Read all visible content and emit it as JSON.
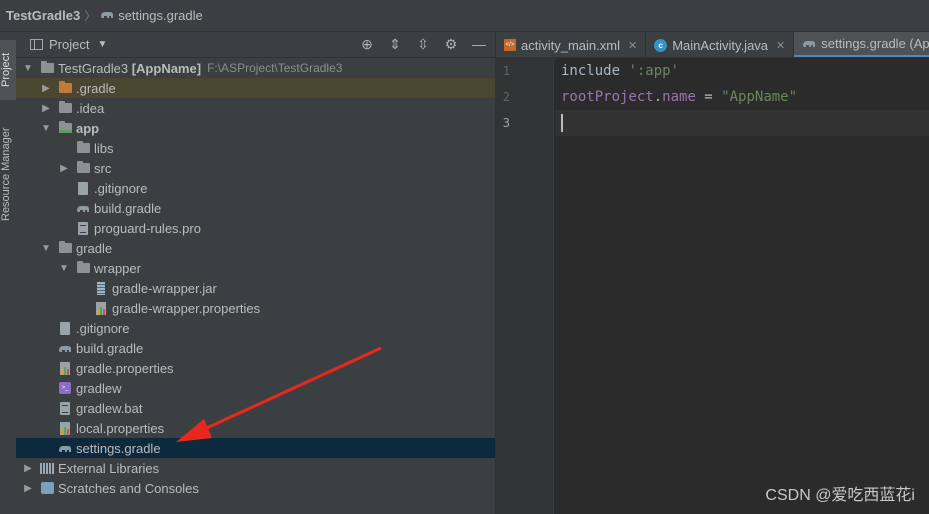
{
  "breadcrumb": {
    "project": "TestGradle3",
    "file": "settings.gradle"
  },
  "side_strip": {
    "project_tab": "Project",
    "resource_tab": "Resource Manager"
  },
  "project_panel": {
    "title": "Project"
  },
  "tree": [
    {
      "label": "TestGradle3",
      "extra": "[AppName]",
      "path": "F:\\ASProject\\TestGradle3",
      "icon": "project-folder-icon",
      "expanded": true,
      "bold": false
    },
    {
      "label": ".gradle",
      "icon": "folder-orange-icon",
      "expanded": false,
      "highlight": true
    },
    {
      "label": ".idea",
      "icon": "folder-icon",
      "expanded": false
    },
    {
      "label": "app",
      "icon": "module-folder-icon",
      "expanded": true,
      "bold": true
    },
    {
      "label": "libs",
      "icon": "folder-icon"
    },
    {
      "label": "src",
      "icon": "folder-icon",
      "expanded": false
    },
    {
      "label": ".gitignore",
      "icon": "gitignore-icon"
    },
    {
      "label": "build.gradle",
      "icon": "gradle-elephant-icon"
    },
    {
      "label": "proguard-rules.pro",
      "icon": "text-file-icon"
    },
    {
      "label": "gradle",
      "icon": "folder-icon",
      "expanded": true
    },
    {
      "label": "wrapper",
      "icon": "folder-icon",
      "expanded": true
    },
    {
      "label": "gradle-wrapper.jar",
      "icon": "jar-icon"
    },
    {
      "label": "gradle-wrapper.properties",
      "icon": "properties-icon"
    },
    {
      "label": ".gitignore",
      "icon": "gitignore-icon"
    },
    {
      "label": "build.gradle",
      "icon": "gradle-elephant-icon"
    },
    {
      "label": "gradle.properties",
      "icon": "properties-icon"
    },
    {
      "label": "gradlew",
      "icon": "gradlew-icon"
    },
    {
      "label": "gradlew.bat",
      "icon": "text-file-icon"
    },
    {
      "label": "local.properties",
      "icon": "properties-icon"
    },
    {
      "label": "settings.gradle",
      "icon": "gradle-elephant-icon",
      "selected": true
    },
    {
      "label": "External Libraries",
      "icon": "libraries-icon",
      "expanded": false
    },
    {
      "label": "Scratches and Consoles",
      "icon": "scratches-icon",
      "expanded": false
    }
  ],
  "tabs": [
    {
      "label": "activity_main.xml",
      "icon": "xml-file-icon",
      "active": false
    },
    {
      "label": "MainActivity.java",
      "icon": "java-class-icon",
      "active": false
    },
    {
      "label": "settings.gradle (App",
      "icon": "gradle-elephant-icon",
      "active": true
    }
  ],
  "editor": {
    "line_numbers": [
      "1",
      "2",
      "3"
    ],
    "line1": {
      "keyword": "include",
      "string": "':app'"
    },
    "line2": {
      "object": "rootProject",
      "dot": ".",
      "property": "name",
      "op": " = ",
      "string": "\"AppName\""
    },
    "current_line": 3
  },
  "watermark": "CSDN @爱吃西蓝花i",
  "colors": {
    "accent": "#4a88c7",
    "selection": "#0d293e",
    "highlight": "#4b4630",
    "arrow": "#e8271f"
  }
}
